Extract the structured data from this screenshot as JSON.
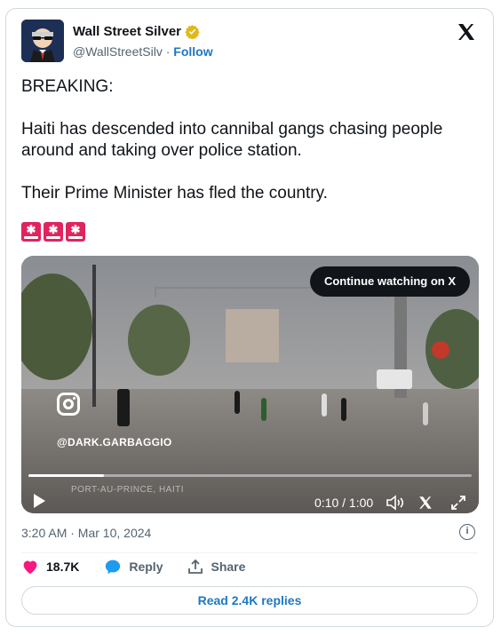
{
  "author": {
    "name": "Wall Street Silver",
    "handle": "@WallStreetSilv",
    "separator": "·",
    "follow_label": "Follow"
  },
  "tweet": {
    "lines": [
      "BREAKING:",
      "Haiti has descended into cannibal gangs chasing people around and taking over police station.",
      "Their Prime Minister has fled the country."
    ],
    "emoji_icons": [
      "police-car-light-icon",
      "police-car-light-icon",
      "police-car-light-icon"
    ]
  },
  "video": {
    "continue_label": "Continue watching on X",
    "watermark": "@DARK.GARBAGGIO",
    "location_caption": "PORT-AU-PRINCE, HAITI",
    "timecode": "0:10 / 1:00",
    "progress": 0.17
  },
  "meta": {
    "timestamp": "3:20 AM · Mar 10, 2024",
    "info_glyph": "i"
  },
  "actions": {
    "likes": "18.7K",
    "reply_label": "Reply",
    "share_label": "Share",
    "read_replies_label": "Read 2.4K replies"
  },
  "colors": {
    "link_blue": "#1d78c4",
    "like_pink": "#f91880",
    "verified_gold": "#e2b719",
    "border": "#cfd9de"
  }
}
